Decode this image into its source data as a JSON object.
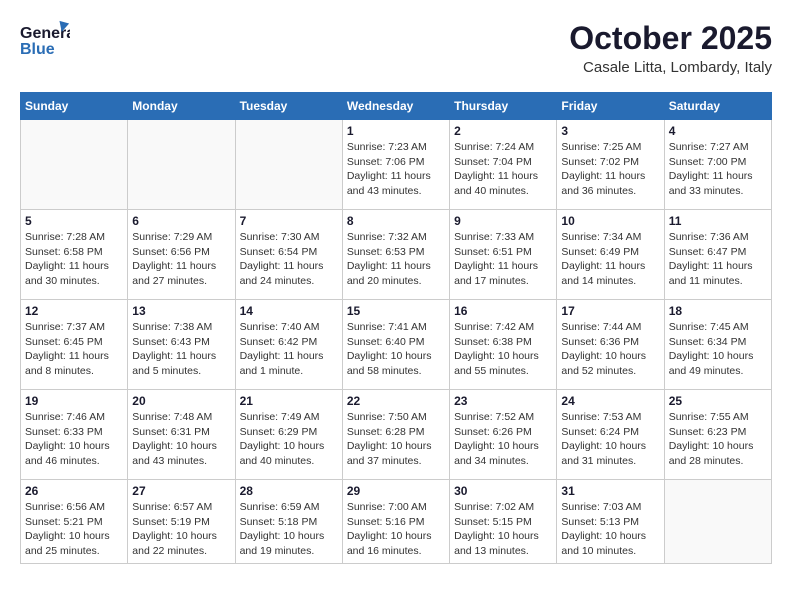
{
  "header": {
    "logo_general": "General",
    "logo_blue": "Blue",
    "month_title": "October 2025",
    "location": "Casale Litta, Lombardy, Italy"
  },
  "weekdays": [
    "Sunday",
    "Monday",
    "Tuesday",
    "Wednesday",
    "Thursday",
    "Friday",
    "Saturday"
  ],
  "weeks": [
    [
      {
        "day": "",
        "info": ""
      },
      {
        "day": "",
        "info": ""
      },
      {
        "day": "",
        "info": ""
      },
      {
        "day": "1",
        "info": "Sunrise: 7:23 AM\nSunset: 7:06 PM\nDaylight: 11 hours\nand 43 minutes."
      },
      {
        "day": "2",
        "info": "Sunrise: 7:24 AM\nSunset: 7:04 PM\nDaylight: 11 hours\nand 40 minutes."
      },
      {
        "day": "3",
        "info": "Sunrise: 7:25 AM\nSunset: 7:02 PM\nDaylight: 11 hours\nand 36 minutes."
      },
      {
        "day": "4",
        "info": "Sunrise: 7:27 AM\nSunset: 7:00 PM\nDaylight: 11 hours\nand 33 minutes."
      }
    ],
    [
      {
        "day": "5",
        "info": "Sunrise: 7:28 AM\nSunset: 6:58 PM\nDaylight: 11 hours\nand 30 minutes."
      },
      {
        "day": "6",
        "info": "Sunrise: 7:29 AM\nSunset: 6:56 PM\nDaylight: 11 hours\nand 27 minutes."
      },
      {
        "day": "7",
        "info": "Sunrise: 7:30 AM\nSunset: 6:54 PM\nDaylight: 11 hours\nand 24 minutes."
      },
      {
        "day": "8",
        "info": "Sunrise: 7:32 AM\nSunset: 6:53 PM\nDaylight: 11 hours\nand 20 minutes."
      },
      {
        "day": "9",
        "info": "Sunrise: 7:33 AM\nSunset: 6:51 PM\nDaylight: 11 hours\nand 17 minutes."
      },
      {
        "day": "10",
        "info": "Sunrise: 7:34 AM\nSunset: 6:49 PM\nDaylight: 11 hours\nand 14 minutes."
      },
      {
        "day": "11",
        "info": "Sunrise: 7:36 AM\nSunset: 6:47 PM\nDaylight: 11 hours\nand 11 minutes."
      }
    ],
    [
      {
        "day": "12",
        "info": "Sunrise: 7:37 AM\nSunset: 6:45 PM\nDaylight: 11 hours\nand 8 minutes."
      },
      {
        "day": "13",
        "info": "Sunrise: 7:38 AM\nSunset: 6:43 PM\nDaylight: 11 hours\nand 5 minutes."
      },
      {
        "day": "14",
        "info": "Sunrise: 7:40 AM\nSunset: 6:42 PM\nDaylight: 11 hours\nand 1 minute."
      },
      {
        "day": "15",
        "info": "Sunrise: 7:41 AM\nSunset: 6:40 PM\nDaylight: 10 hours\nand 58 minutes."
      },
      {
        "day": "16",
        "info": "Sunrise: 7:42 AM\nSunset: 6:38 PM\nDaylight: 10 hours\nand 55 minutes."
      },
      {
        "day": "17",
        "info": "Sunrise: 7:44 AM\nSunset: 6:36 PM\nDaylight: 10 hours\nand 52 minutes."
      },
      {
        "day": "18",
        "info": "Sunrise: 7:45 AM\nSunset: 6:34 PM\nDaylight: 10 hours\nand 49 minutes."
      }
    ],
    [
      {
        "day": "19",
        "info": "Sunrise: 7:46 AM\nSunset: 6:33 PM\nDaylight: 10 hours\nand 46 minutes."
      },
      {
        "day": "20",
        "info": "Sunrise: 7:48 AM\nSunset: 6:31 PM\nDaylight: 10 hours\nand 43 minutes."
      },
      {
        "day": "21",
        "info": "Sunrise: 7:49 AM\nSunset: 6:29 PM\nDaylight: 10 hours\nand 40 minutes."
      },
      {
        "day": "22",
        "info": "Sunrise: 7:50 AM\nSunset: 6:28 PM\nDaylight: 10 hours\nand 37 minutes."
      },
      {
        "day": "23",
        "info": "Sunrise: 7:52 AM\nSunset: 6:26 PM\nDaylight: 10 hours\nand 34 minutes."
      },
      {
        "day": "24",
        "info": "Sunrise: 7:53 AM\nSunset: 6:24 PM\nDaylight: 10 hours\nand 31 minutes."
      },
      {
        "day": "25",
        "info": "Sunrise: 7:55 AM\nSunset: 6:23 PM\nDaylight: 10 hours\nand 28 minutes."
      }
    ],
    [
      {
        "day": "26",
        "info": "Sunrise: 6:56 AM\nSunset: 5:21 PM\nDaylight: 10 hours\nand 25 minutes."
      },
      {
        "day": "27",
        "info": "Sunrise: 6:57 AM\nSunset: 5:19 PM\nDaylight: 10 hours\nand 22 minutes."
      },
      {
        "day": "28",
        "info": "Sunrise: 6:59 AM\nSunset: 5:18 PM\nDaylight: 10 hours\nand 19 minutes."
      },
      {
        "day": "29",
        "info": "Sunrise: 7:00 AM\nSunset: 5:16 PM\nDaylight: 10 hours\nand 16 minutes."
      },
      {
        "day": "30",
        "info": "Sunrise: 7:02 AM\nSunset: 5:15 PM\nDaylight: 10 hours\nand 13 minutes."
      },
      {
        "day": "31",
        "info": "Sunrise: 7:03 AM\nSunset: 5:13 PM\nDaylight: 10 hours\nand 10 minutes."
      },
      {
        "day": "",
        "info": ""
      }
    ]
  ]
}
